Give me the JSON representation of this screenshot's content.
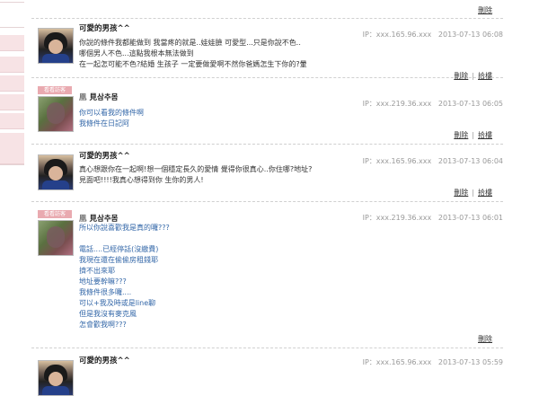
{
  "sidebar_item_count": 8,
  "labels": {
    "delete": "刪除",
    "reply": "拾樓",
    "separator": "|",
    "guest_badge": "看看訪客",
    "pin": "凰"
  },
  "comments": [
    {
      "name": "可愛的男孩^^",
      "ip": "IP：xxx.165.96.xxx",
      "time": "2013-07-13 06:08",
      "lines": [
        "你說的條件我都能做到 我當疼的就是..娃娃臉 可愛型...只是你說不色..",
        "哪個男人不色...這點我根本無法做到",
        "在一起怎可能不色?結婚 生孩子 一定要做愛啊不然你爸媽怎生下你的?暈"
      ]
    },
    {
      "name": "見삼추몸",
      "ip": "IP：xxx.219.36.xxx",
      "time": "2013-07-13 06:05",
      "lines": [
        "你可以看我的條件啊",
        "我條件在日記阿"
      ]
    },
    {
      "name": "可愛的男孩^^",
      "ip": "IP：xxx.165.96.xxx",
      "time": "2013-07-13 06:04",
      "lines": [
        "真心想跟你在一起啊!想一個穩定長久的愛情 覺得你很真心..你住哪?地址?",
        "見面吧!!!!我真心想得到你 生你的男人!"
      ]
    },
    {
      "name": "見삼추몸",
      "ip": "IP：xxx.219.36.xxx",
      "time": "2013-07-13 06:01",
      "lines": [
        "所以你說喜歡我是真的囉???",
        "",
        "電話....已經停話(沒繳費)",
        "我現在還在偷偷房租錢耶",
        "擠不出來耶",
        "地址要幹嘛???",
        "我條件很多囉....",
        "可以+我及時或是line聊",
        "但是我沒有麥克風",
        "怎會歡我啊???"
      ]
    },
    {
      "name": "可愛的男孩^^",
      "ip": "IP：xxx.165.96.xxx",
      "time": "2013-07-13 05:59",
      "lines": []
    }
  ]
}
